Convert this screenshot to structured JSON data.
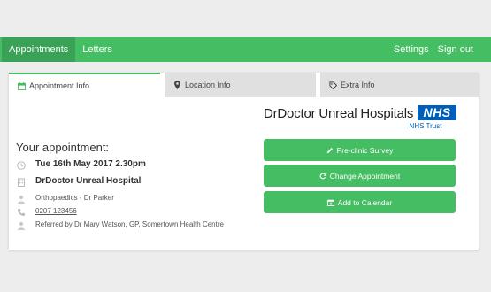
{
  "nav": {
    "left": [
      {
        "label": "Appointments",
        "active": true
      },
      {
        "label": "Letters",
        "active": false
      }
    ],
    "right": [
      {
        "label": "Settings"
      },
      {
        "label": "Sign out"
      }
    ]
  },
  "tabs": [
    {
      "label": "Appointment Info",
      "icon": "calendar-icon",
      "active": true
    },
    {
      "label": "Location Info",
      "icon": "map-pin-icon",
      "active": false
    },
    {
      "label": "Extra Info",
      "icon": "tag-icon",
      "active": false
    }
  ],
  "logo": {
    "name": "DrDoctor Unreal Hospitals",
    "badge": "NHS",
    "trust": "NHS Trust"
  },
  "appointment": {
    "title": "Your appointment:",
    "datetime": "Tue 16th May 2017 2.30pm",
    "hospital": "DrDoctor Unreal Hospital",
    "department": "Orthopaedics - Dr Parker",
    "phone": "0207 123456",
    "referral": "Referred by Dr Mary Watson, GP, Somertown Health Centre"
  },
  "actions": [
    {
      "label": "Pre-clinic Survey",
      "icon": "pencil-icon"
    },
    {
      "label": "Change Appointment",
      "icon": "refresh-icon"
    },
    {
      "label": "Add to Calendar",
      "icon": "calendar-plus-icon"
    }
  ],
  "colors": {
    "primary": "#45bd63",
    "nav_active": "#3aa257",
    "nhs_blue": "#005eb8",
    "page_bg": "#ededed"
  }
}
